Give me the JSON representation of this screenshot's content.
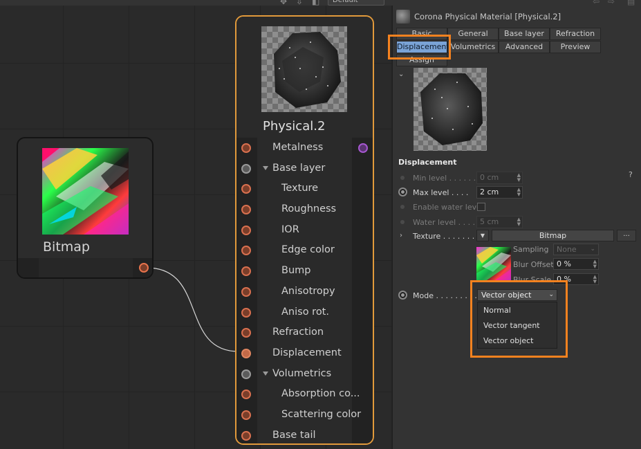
{
  "toolbar": {
    "preset_value": "Default"
  },
  "bitmap_node": {
    "title": "Bitmap"
  },
  "physical_node": {
    "title": "Physical.2",
    "ports": [
      {
        "label": "Metalness",
        "indent": 0,
        "dot": "orange",
        "right_port": true
      },
      {
        "label": "Base layer",
        "indent": 0,
        "dot": "grey",
        "group": true
      },
      {
        "label": "Texture",
        "indent": 1,
        "dot": "orange"
      },
      {
        "label": "Roughness",
        "indent": 1,
        "dot": "orange"
      },
      {
        "label": "IOR",
        "indent": 1,
        "dot": "orange"
      },
      {
        "label": "Edge color",
        "indent": 1,
        "dot": "orange"
      },
      {
        "label": "Bump",
        "indent": 1,
        "dot": "orange"
      },
      {
        "label": "Anisotropy",
        "indent": 1,
        "dot": "orange"
      },
      {
        "label": "Aniso rot.",
        "indent": 1,
        "dot": "orange"
      },
      {
        "label": "Refraction",
        "indent": 0,
        "dot": "orange"
      },
      {
        "label": "Displacement",
        "indent": 0,
        "dot": "filled"
      },
      {
        "label": "Volumetrics",
        "indent": 0,
        "dot": "grey",
        "group": true
      },
      {
        "label": "Absorption co...",
        "indent": 1,
        "dot": "orange"
      },
      {
        "label": "Scattering color",
        "indent": 1,
        "dot": "orange"
      },
      {
        "label": "Base tail",
        "indent": 0,
        "dot": "orange"
      }
    ]
  },
  "panel": {
    "material_title": "Corona Physical Material [Physical.2]",
    "tabs_row1": [
      "Basic",
      "General",
      "Base layer",
      "Refraction"
    ],
    "tabs_row2": [
      "Displacement",
      "Volumetrics",
      "Advanced",
      "Preview"
    ],
    "tabs_row3": [
      "Assign"
    ],
    "active_tab": "Displacement",
    "section_title": "Displacement",
    "help": "?",
    "attributes": {
      "min_level": {
        "label": "Min level . . . . . .",
        "value": "0 cm"
      },
      "max_level": {
        "label": "Max level . . . .",
        "value": "2 cm"
      },
      "enable_water_level": {
        "label": "Enable water level"
      },
      "water_level": {
        "label": "Water level . . . .",
        "value": "5 cm"
      },
      "texture": {
        "label": "Texture . . . . . . .",
        "button": "Bitmap",
        "more": "..."
      },
      "sampling": {
        "label": "Sampling",
        "value": "None"
      },
      "blur_offset": {
        "label": "Blur Offset",
        "value": "0 %"
      },
      "blur_scale": {
        "label": "Blur Scale",
        "value": "0 %"
      },
      "mode": {
        "label": "Mode . . . . . . . . .",
        "value": "Vector object"
      }
    },
    "mode_options": [
      "Normal",
      "Vector tangent",
      "Vector object"
    ]
  },
  "colors": {
    "highlight": "#f5821f",
    "node_border_selected": "#e29a3b",
    "tab_active": "#7aa3d6"
  }
}
